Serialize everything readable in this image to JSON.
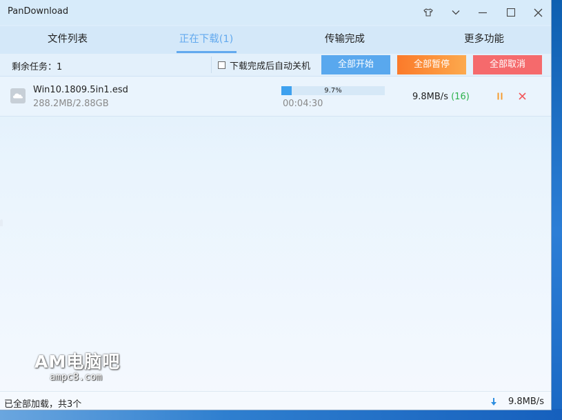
{
  "window": {
    "title": "PanDownload"
  },
  "tabs": [
    {
      "label": "文件列表"
    },
    {
      "label": "正在下载(1)"
    },
    {
      "label": "传输完成"
    },
    {
      "label": "更多功能"
    }
  ],
  "toolbar": {
    "remaining_label": "剩余任务：",
    "remaining_count": "1",
    "auto_shutdown_label": "下载完成后自动关机",
    "auto_shutdown_checked": false,
    "start_all_label": "全部开始",
    "pause_all_label": "全部暂停",
    "cancel_all_label": "全部取消"
  },
  "downloads": [
    {
      "name": "Win10.1809.5in1.esd",
      "size": "288.2MB/2.88GB",
      "progress_label": "9.7%",
      "progress": 0.097,
      "elapsed": "00:04:30",
      "speed": "9.8MB/s",
      "connections": "(16)"
    }
  ],
  "status": {
    "message": "已全部加载，共3个",
    "speed": "9.8MB/s"
  },
  "watermark": {
    "logo": "AM电脑吧",
    "url": "ampc8.com"
  },
  "colors": {
    "accent": "#62a9ee",
    "start_button": "#59a8ee",
    "pause_button": "#fb7a2a",
    "cancel_button": "#f56a6c",
    "progress": "#3ea1ef",
    "connections": "#2bb14a"
  },
  "icons": {
    "skin": "shirt-icon",
    "menu": "chevron-down-icon",
    "minimize": "minimize-icon",
    "maximize": "maximize-icon",
    "close": "close-icon",
    "file": "cloud-file-icon",
    "row_pause": "pause-icon",
    "row_cancel": "cancel-x-icon",
    "status_download": "download-arrow-icon"
  }
}
